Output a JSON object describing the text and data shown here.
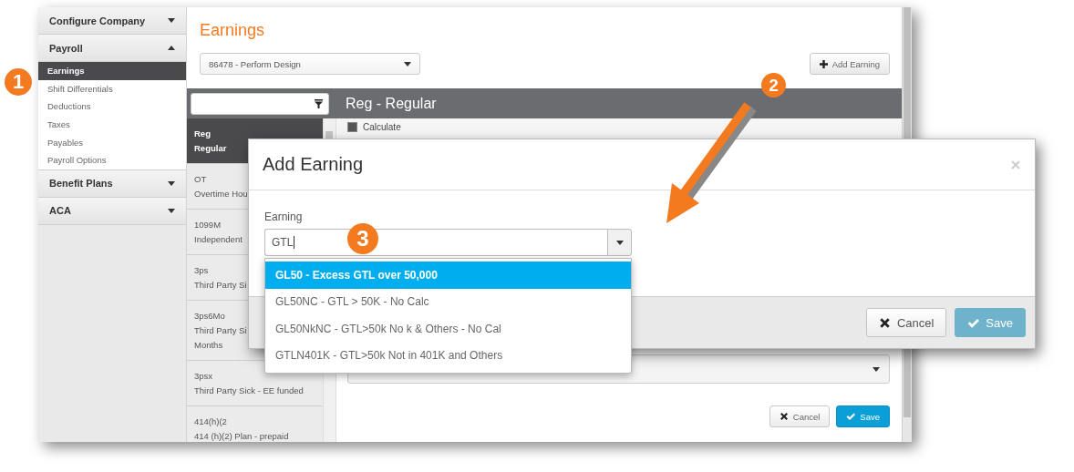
{
  "sidebar": {
    "sections": [
      {
        "label": "Configure Company",
        "expanded": false
      },
      {
        "label": "Payroll",
        "expanded": true,
        "items": [
          {
            "label": "Earnings",
            "selected": true
          },
          {
            "label": "Shift Differentials",
            "selected": false
          },
          {
            "label": "Deductions",
            "selected": false
          },
          {
            "label": "Taxes",
            "selected": false
          },
          {
            "label": "Payables",
            "selected": false
          },
          {
            "label": "Payroll Options",
            "selected": false
          }
        ]
      },
      {
        "label": "Benefit Plans",
        "expanded": false
      },
      {
        "label": "ACA",
        "expanded": false
      }
    ]
  },
  "page": {
    "title": "Earnings",
    "company_select": {
      "value": "86478 - Perform Design"
    },
    "add_button": "Add Earning"
  },
  "earnings_list": {
    "items": [
      {
        "code": "Reg",
        "lines": [
          "Regular"
        ],
        "selected": true
      },
      {
        "code": "OT",
        "lines": [
          "Overtime Hou"
        ],
        "selected": false
      },
      {
        "code": "1099M",
        "lines": [
          "Independent"
        ],
        "selected": false
      },
      {
        "code": "3ps",
        "lines": [
          "Third Party Si"
        ],
        "selected": false
      },
      {
        "code": "3ps6Mo",
        "lines": [
          "Third Party Si",
          "Months"
        ],
        "selected": false
      },
      {
        "code": "3psx",
        "lines": [
          "Third Party Sick - EE funded"
        ],
        "selected": false
      },
      {
        "code": "414(h)(2",
        "lines": [
          "414 (h)(2) Plan - prepaid"
        ],
        "selected": false
      }
    ]
  },
  "detail": {
    "title": "Reg - Regular",
    "calculate": {
      "label": "Calculate",
      "checked": true
    },
    "buttons": [
      {
        "label": "Cancel",
        "kind": "default",
        "disabled": false
      },
      {
        "label": "Save",
        "kind": "primary",
        "disabled": false
      }
    ]
  },
  "dialog": {
    "title": "Add Earning",
    "field_label": "Earning",
    "value": "GTL",
    "options": [
      {
        "label": "GL50 - Excess GTL over 50,000",
        "selected": true
      },
      {
        "label": "GL50NC - GTL > 50K - No Calc",
        "selected": false
      },
      {
        "label": "GL50NkNC - GTL>50k No k & Others - No Cal",
        "selected": false
      },
      {
        "label": "GTLN401K - GTL>50k Not in 401K and Others",
        "selected": false
      }
    ],
    "buttons": [
      {
        "label": "Cancel",
        "kind": "default",
        "disabled": false
      },
      {
        "label": "Save",
        "kind": "primary",
        "disabled": true
      }
    ]
  },
  "annotations": [
    {
      "label": "1"
    },
    {
      "label": "2"
    },
    {
      "label": "3"
    }
  ]
}
